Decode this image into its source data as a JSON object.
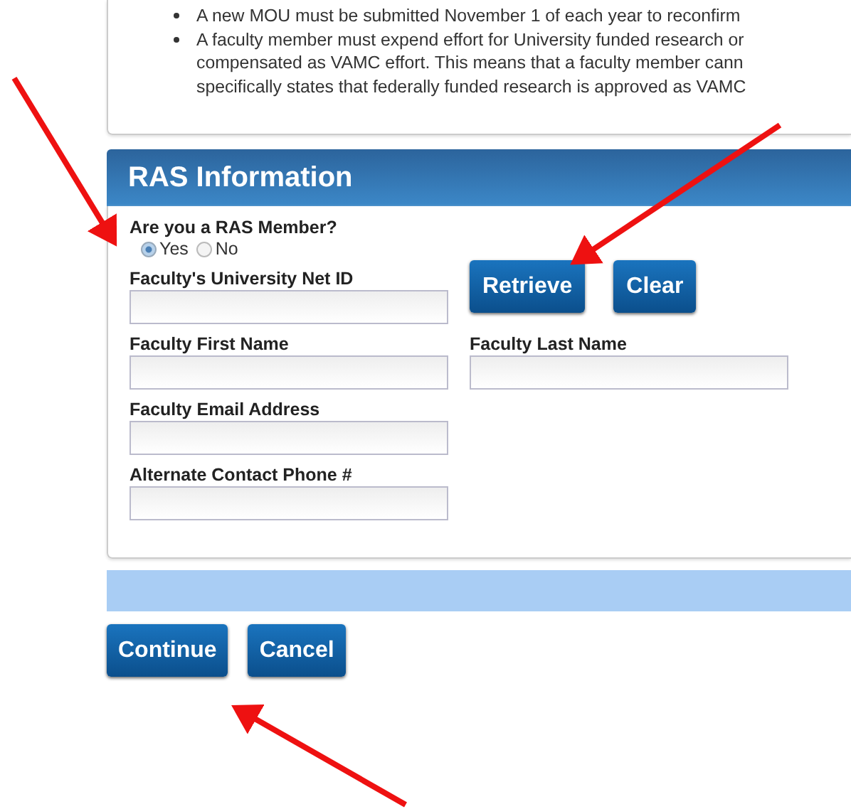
{
  "notes": [
    {
      "lines": [
        "A new MOU must be submitted November 1 of each year to reconfirm"
      ]
    },
    {
      "lines": [
        "A faculty member must expend effort for University funded research or",
        "compensated as VAMC effort. This means that a faculty member cann",
        "specifically states that federally funded research is approved as VAMC"
      ]
    }
  ],
  "section": {
    "title": "RAS Information",
    "question": "Are you a RAS Member?",
    "options": [
      {
        "label": "Yes",
        "selected": true
      },
      {
        "label": "No",
        "selected": false
      }
    ],
    "net_id": {
      "label": "Faculty's University Net ID"
    },
    "actions": [
      "Retrieve",
      "Clear"
    ],
    "first_name": {
      "label": "Faculty First Name"
    },
    "last_name": {
      "label": "Faculty Last Name"
    },
    "email": {
      "label": "Faculty Email Address"
    },
    "phone": {
      "label": "Alternate Contact Phone #"
    }
  },
  "buttons": [
    "Continue",
    "Cancel"
  ]
}
